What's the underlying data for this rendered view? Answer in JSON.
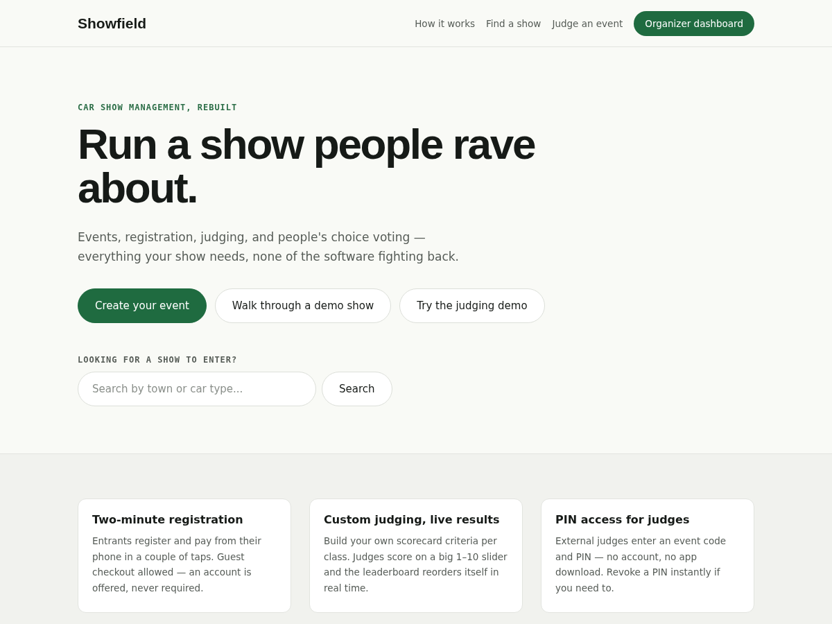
{
  "header": {
    "logo": "Showfield",
    "nav": [
      {
        "label": "How it works",
        "kind": "link"
      },
      {
        "label": "Find a show",
        "kind": "link"
      },
      {
        "label": "Judge an event",
        "kind": "link"
      },
      {
        "label": "Organizer dashboard",
        "kind": "primary"
      }
    ]
  },
  "hero": {
    "eyebrow": "CAR SHOW MANAGEMENT, REBUILT",
    "title": "Run a show people rave about.",
    "subtitle": "Events, registration, judging, and people's choice voting — everything your show needs, none of the software fighting back.",
    "actions": [
      {
        "label": "Create your event",
        "kind": "primary"
      },
      {
        "label": "Walk through a demo show",
        "kind": "secondary"
      },
      {
        "label": "Try the judging demo",
        "kind": "secondary"
      }
    ],
    "search": {
      "label": "LOOKING FOR A SHOW TO ENTER?",
      "placeholder": "Search by town or car type...",
      "button": "Search"
    }
  },
  "features": [
    {
      "title": "Two-minute registration",
      "text": "Entrants register and pay from their phone in a couple of taps. Guest checkout allowed — an account is offered, never required."
    },
    {
      "title": "Custom judging, live results",
      "text": "Build your own scorecard criteria per class. Judges score on a big 1–10 slider and the leaderboard reorders itself in real time."
    },
    {
      "title": "PIN access for judges",
      "text": "External judges enter an event code and PIN — no account, no app download. Revoke a PIN instantly if you need to."
    }
  ]
}
